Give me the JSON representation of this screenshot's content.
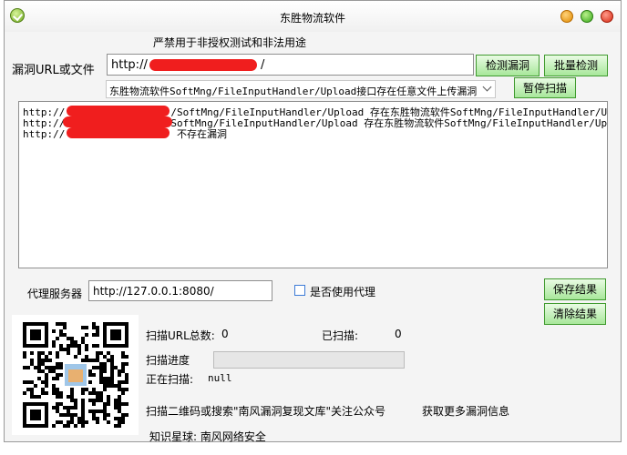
{
  "window": {
    "title": "东胜物流软件"
  },
  "warning": "严禁用于非授权测试和非法用途",
  "url": {
    "label": "漏洞URL或文件",
    "prefix": "http://",
    "suffix": "/"
  },
  "buttons": {
    "detect": "检测漏洞",
    "batch": "批量检测",
    "pause": "暂停扫描",
    "save": "保存结果",
    "clear": "清除结果"
  },
  "vuln_select": {
    "selected": "东胜物流软件SoftMng/FileInputHandler/Upload接口存在任意文件上传漏洞"
  },
  "output": {
    "lines": [
      {
        "prefix": "http://",
        "rest": "/SoftMng/FileInputHandler/Upload  存在东胜物流软件SoftMng/FileInputHandler/Upload"
      },
      {
        "prefix": "http://",
        "rest": "SoftMng/FileInputHandler/Upload  存在东胜物流软件SoftMng/FileInputHandler/Upload"
      },
      {
        "prefix": "http://",
        "rest": " 不存在漏洞"
      }
    ]
  },
  "proxy": {
    "label": "代理服务器",
    "value": "http://127.0.0.1:8080/",
    "use_label": "是否使用代理",
    "use_checked": false
  },
  "stats": {
    "total_label": "扫描URL总数:",
    "total_value": "0",
    "scanned_label": "已扫描:",
    "scanned_value": "0",
    "progress_label": "扫描进度",
    "progress": 0,
    "scanning_label": "正在扫描:",
    "scanning_value": "null"
  },
  "promo": {
    "qr_text": "扫描二维码或搜索\"南风漏洞复现文库\"关注公众号",
    "more_text": "获取更多漏洞信息",
    "planet": "知识星球: 南风网络安全"
  },
  "colors": {
    "button_green": "#a7e79a",
    "redaction": "#f01e1e"
  }
}
